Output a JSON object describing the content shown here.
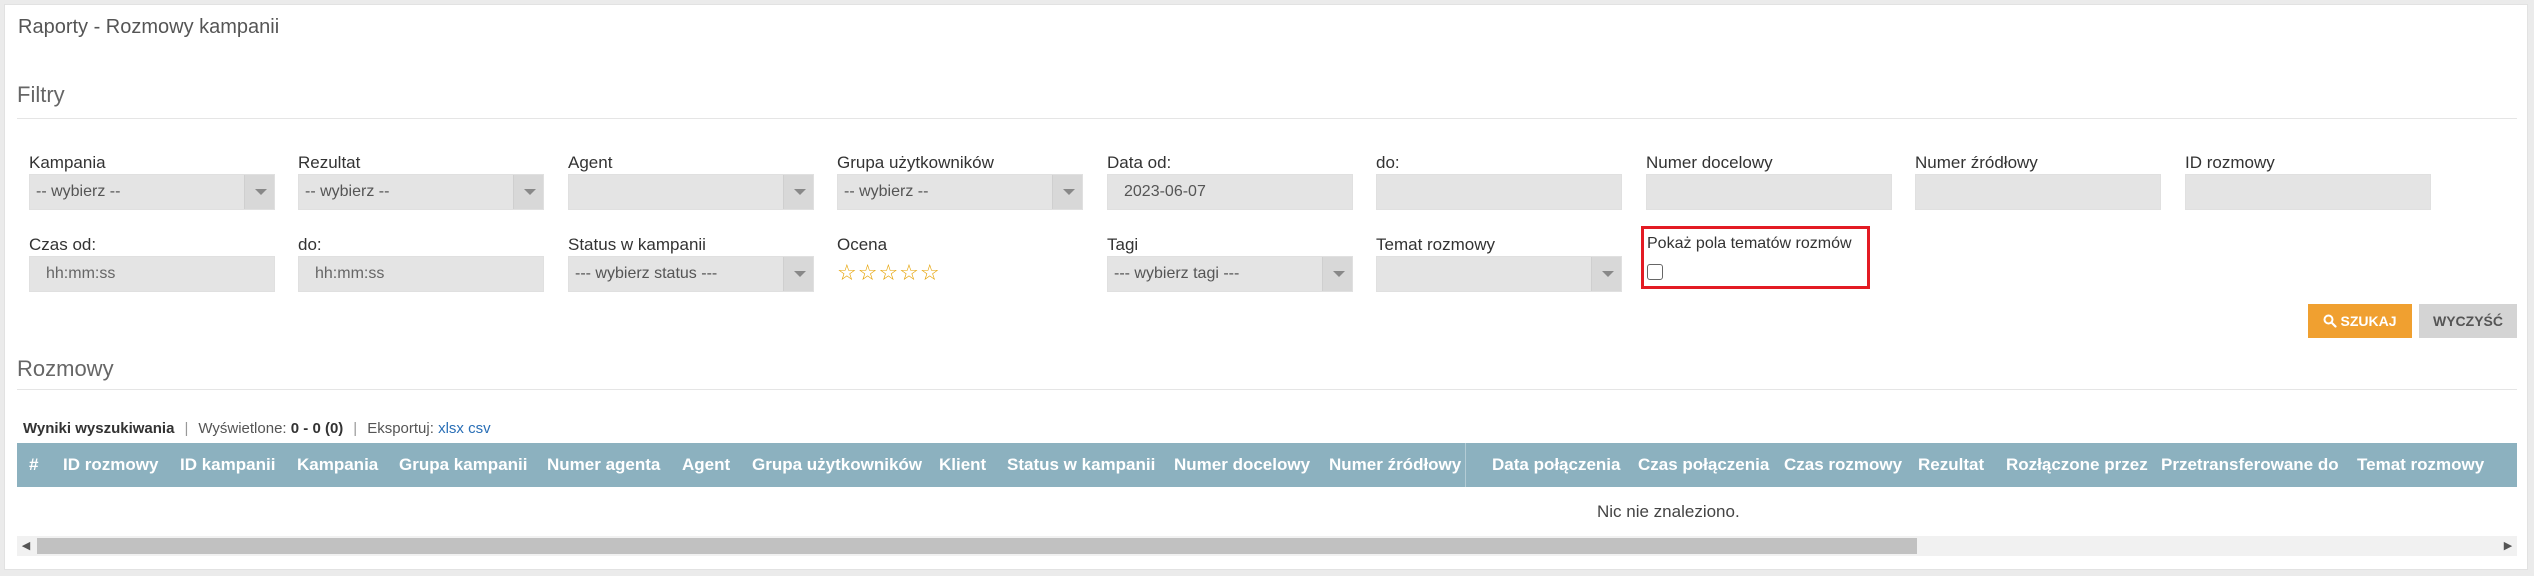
{
  "page": {
    "title": "Raporty - Rozmowy kampanii"
  },
  "filters": {
    "title": "Filtry",
    "kampania": {
      "label": "Kampania",
      "value": "-- wybierz --"
    },
    "rezultat": {
      "label": "Rezultat",
      "value": "-- wybierz --"
    },
    "agent": {
      "label": "Agent",
      "value": ""
    },
    "grupa": {
      "label": "Grupa użytkowników",
      "value": "-- wybierz --"
    },
    "data_od": {
      "label": "Data od:",
      "value": "2023-06-07"
    },
    "data_do": {
      "label": "do:",
      "value": ""
    },
    "numer_docelowy": {
      "label": "Numer docelowy",
      "value": ""
    },
    "numer_zrodlowy": {
      "label": "Numer źródłowy",
      "value": ""
    },
    "id_rozmowy": {
      "label": "ID rozmowy",
      "value": ""
    },
    "czas_od": {
      "label": "Czas od:",
      "placeholder": "hh:mm:ss"
    },
    "czas_do": {
      "label": "do:",
      "placeholder": "hh:mm:ss"
    },
    "status": {
      "label": "Status w kampanii",
      "value": "--- wybierz status ---"
    },
    "ocena": {
      "label": "Ocena",
      "stars": "☆☆☆☆☆",
      "rating": 0,
      "max": 5
    },
    "tagi": {
      "label": "Tagi",
      "value": "--- wybierz tagi ---"
    },
    "temat": {
      "label": "Temat rozmowy",
      "value": ""
    },
    "pokaz": {
      "label": "Pokaż pola tematów rozmów",
      "checked": false
    }
  },
  "buttons": {
    "search": "SZUKAJ",
    "clear": "WYCZYŚĆ"
  },
  "results": {
    "title": "Rozmowy",
    "summary_label": "Wyniki wyszukiwania",
    "displayed_label": "Wyświetlone:",
    "displayed_value": "0 - 0 (0)",
    "export_label": "Eksportuj:",
    "export_xlsx": "xlsx",
    "export_csv": "csv",
    "columns": [
      "#",
      "ID rozmowy",
      "ID kampanii",
      "Kampania",
      "Grupa kampanii",
      "Numer agenta",
      "Agent",
      "Grupa użytkowników",
      "Klient",
      "Status w kampanii",
      "Numer docelowy",
      "Numer źródłowy",
      "Data połączenia",
      "Czas połączenia",
      "Czas rozmowy",
      "Rezultat",
      "Rozłączone przez",
      "Przetransferowane do",
      "Temat rozmowy"
    ],
    "empty_message": "Nic nie znaleziono."
  },
  "colors": {
    "header_bg": "#8cb1bf",
    "search_btn": "#f0a030",
    "highlight": "#e31b23",
    "stars": "#e5a100"
  },
  "icons": {
    "search": "search-icon",
    "scroll_left": "scroll-left-icon",
    "scroll_right": "scroll-right-icon"
  }
}
